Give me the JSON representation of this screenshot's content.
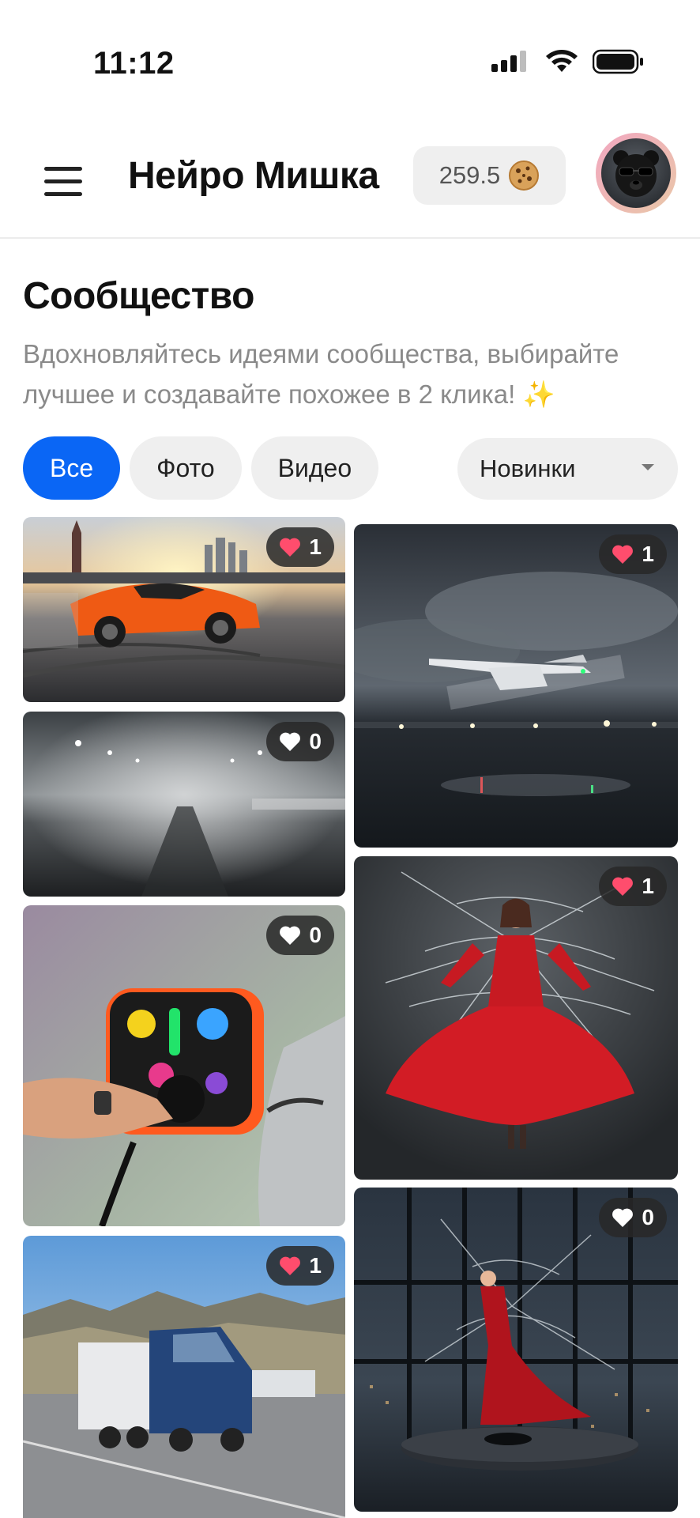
{
  "status": {
    "time": "11:12"
  },
  "header": {
    "title": "Нейро Мишка",
    "balance": "259.5",
    "balance_icon": "cookie-icon"
  },
  "section": {
    "title": "Сообщество",
    "description": "Вдохновляйтесь идеями сообщества, выбирайте лучшее и создавайте похожее в 2 клика! ✨"
  },
  "filters": {
    "all": "Все",
    "photo": "Фото",
    "video": "Видео",
    "sort": "Новинки"
  },
  "colors": {
    "accent": "#0a66f5",
    "liked": "#ff4d6d",
    "chip_bg": "#efefef"
  },
  "cards": [
    {
      "likes": "1",
      "liked": true
    },
    {
      "likes": "0",
      "liked": false
    },
    {
      "likes": "0",
      "liked": false
    },
    {
      "likes": "1",
      "liked": true
    },
    {
      "likes": "1",
      "liked": true
    },
    {
      "likes": "1",
      "liked": true
    },
    {
      "likes": "0",
      "liked": false
    }
  ]
}
